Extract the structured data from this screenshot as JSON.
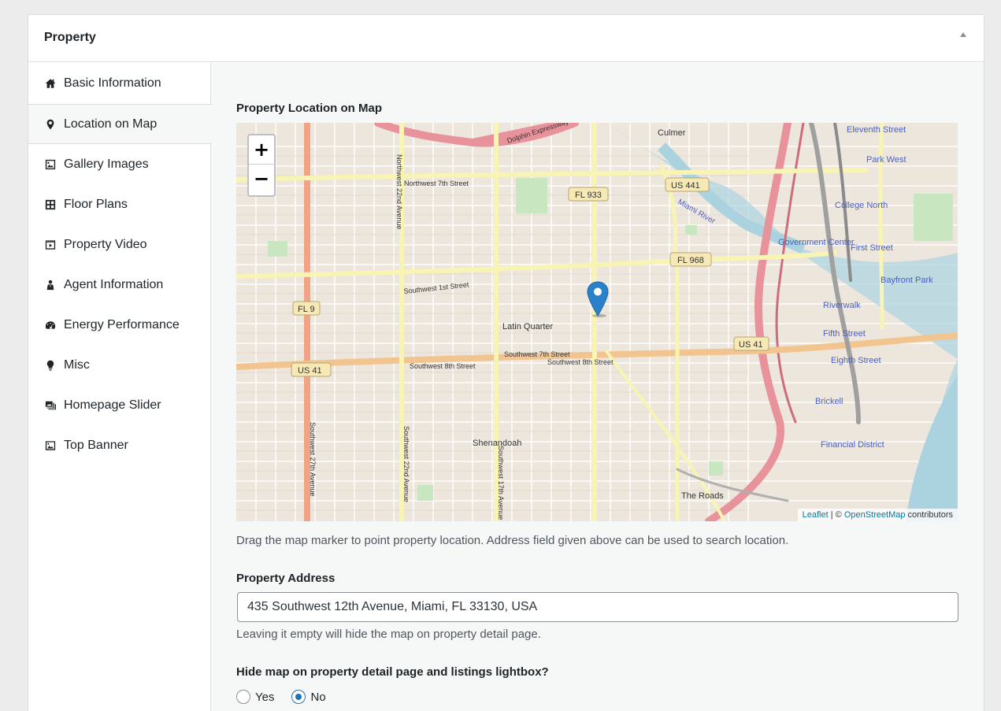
{
  "metabox": {
    "title": "Property"
  },
  "tabs": [
    {
      "label": "Basic Information",
      "icon": "home-icon"
    },
    {
      "label": "Location on Map",
      "icon": "location-pin-icon"
    },
    {
      "label": "Gallery Images",
      "icon": "gallery-icon"
    },
    {
      "label": "Floor Plans",
      "icon": "floor-plan-icon"
    },
    {
      "label": "Property Video",
      "icon": "video-icon"
    },
    {
      "label": "Agent Information",
      "icon": "agent-icon"
    },
    {
      "label": "Energy Performance",
      "icon": "dashboard-icon"
    },
    {
      "label": "Misc",
      "icon": "lightbulb-icon"
    },
    {
      "label": "Homepage Slider",
      "icon": "slider-icon"
    },
    {
      "label": "Top Banner",
      "icon": "banner-image-icon"
    }
  ],
  "active_tab": "Location on Map",
  "location": {
    "section_title": "Property Location on Map",
    "map": {
      "zoom_in": "+",
      "zoom_out": "−",
      "labels": {
        "culmer": "Culmer",
        "eleventh": "Eleventh Street",
        "park_west": "Park West",
        "college": "College North",
        "government": "Government Center",
        "first_street": "First Street",
        "bayfront": "Bayfront Park",
        "riverwalk": "Riverwalk",
        "fifth_street": "Fifth Street",
        "eighth_street": "Eighth Street",
        "brickell": "Brickell",
        "financial": "Financial District",
        "latin_quarter": "Latin Quarter",
        "shenandoah": "Shenandoah",
        "the_roads": "The Roads",
        "miami_river": "Miami River",
        "nw7": "Northwest 7th Street",
        "sw1": "Southwest 1st Street",
        "sw7": "Southwest 7th Street",
        "sw8a": "Southwest 8th Street",
        "sw8b": "Southwest 8th Street",
        "nw22": "Northwest 22nd Avenue",
        "sw27": "Southwest 27th Avenue",
        "sw22": "Southwest 22nd Avenue",
        "sw17": "Southwest 17th Avenue",
        "dolphin": "Dolphin Expressway",
        "fl933": "FL 933",
        "fl968": "FL 968",
        "fl9": "FL 9",
        "us441": "US 441",
        "us41a": "US 41",
        "us41b": "US 41"
      },
      "attribution": {
        "leaflet": "Leaflet",
        "sep": " | © ",
        "osm": "OpenStreetMap",
        "contrib": " contributors"
      }
    },
    "help_text": "Drag the map marker to point property location. Address field given above can be used to search location.",
    "address_label": "Property Address",
    "address_value": "435 Southwest 12th Avenue, Miami, FL 33130, USA",
    "address_help": "Leaving it empty will hide the map on property detail page.",
    "hide_map_label": "Hide map on property detail page and listings lightbox?",
    "hide_map_options": [
      {
        "label": "Yes",
        "checked": false
      },
      {
        "label": "No",
        "checked": true
      }
    ]
  },
  "colors": {
    "accent": "#2271b1",
    "marker": "#2a81cb",
    "highway": "#e8929c",
    "trunk": "#f2c48f",
    "road": "#f8f4b4",
    "water": "#aad3df"
  }
}
